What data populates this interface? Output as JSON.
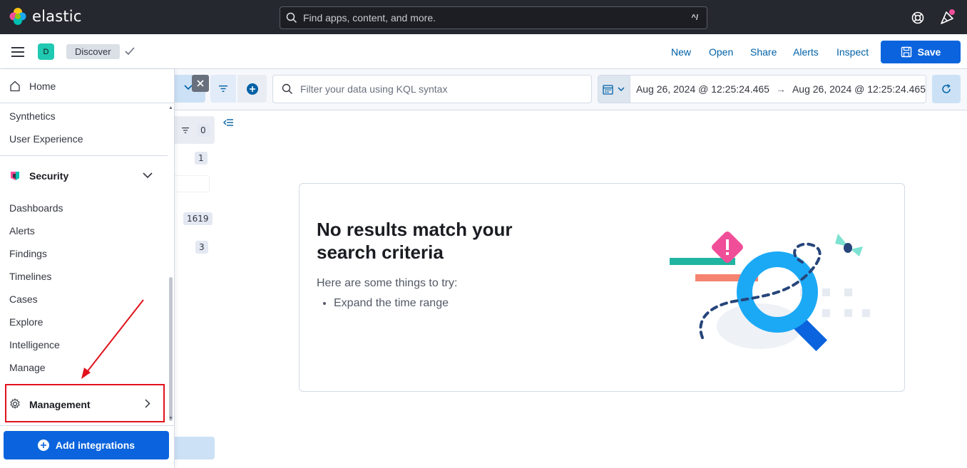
{
  "topbar": {
    "logo_text": "elastic",
    "search_placeholder": "Find apps, content, and more.",
    "search_shortcut": "^/"
  },
  "header": {
    "space_initial": "D",
    "breadcrumb": "Discover",
    "links": [
      "New",
      "Open",
      "Share",
      "Alerts",
      "Inspect"
    ],
    "save_label": "Save"
  },
  "query": {
    "kql_placeholder": "Filter your data using KQL syntax",
    "date_start": "Aug 26, 2024 @ 12:25:24.465",
    "date_arrow": "→",
    "date_end": "Aug 26, 2024 @ 12:25:24.465"
  },
  "fields": {
    "filter_count": "0",
    "counts": [
      "1",
      "1619",
      "3"
    ]
  },
  "empty_prompt": {
    "title": "No results match your search criteria",
    "subtitle": "Here are some things to try:",
    "tips": [
      "Expand the time range"
    ]
  },
  "sidenav": {
    "home": "Home",
    "observability_items": [
      "Synthetics",
      "User Experience"
    ],
    "security_label": "Security",
    "security_items": [
      "Dashboards",
      "Alerts",
      "Findings",
      "Timelines",
      "Cases",
      "Explore",
      "Intelligence",
      "Manage"
    ],
    "management_label": "Management",
    "add_integrations": "Add integrations"
  },
  "colors": {
    "topbar_bg": "#25282f",
    "primary": "#0b64dd",
    "link": "#0061a6",
    "annotation_red": "#e0121c"
  }
}
